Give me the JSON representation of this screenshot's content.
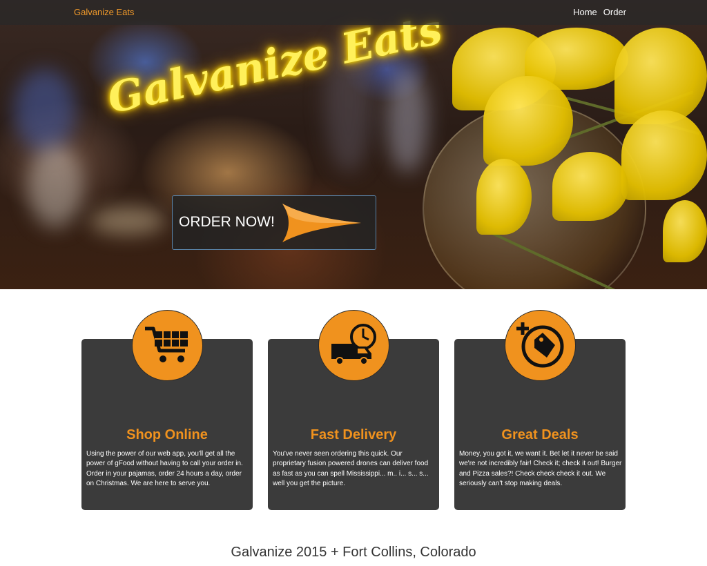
{
  "navbar": {
    "brand": "Galvanize Eats",
    "links": [
      "Home",
      "Order"
    ]
  },
  "hero": {
    "neon_title": "Galvanize Eats",
    "order_button_label": "ORDER NOW!"
  },
  "features": [
    {
      "icon": "shopping-cart-icon",
      "title": "Shop Online",
      "text": "Using the power of our web app, you'll get all the power of gFood without having to call your order in. Order in your pajamas, order 24 hours a day, order on Christmas. We are here to serve you."
    },
    {
      "icon": "delivery-truck-icon",
      "title": "Fast Delivery",
      "text": "You've never seen ordering this quick. Our proprietary fusion powered drones can deliver food as fast as you can spell Mississippi... m.. i... s... s... well you get the picture."
    },
    {
      "icon": "price-tag-icon",
      "title": "Great Deals",
      "text": "Money, you got it, we want it. Bet let it never be said we're not incredibly fair! Check it; check it out! Burger and Pizza sales?! Check check check it out. We seriously can't stop making deals."
    }
  ],
  "footer": {
    "text": "Galvanize 2015 + Fort Collins, Colorado"
  },
  "colors": {
    "accent": "#f0921e",
    "card_bg": "#3b3b3b",
    "navbar_bg": "#2a2a2a"
  }
}
